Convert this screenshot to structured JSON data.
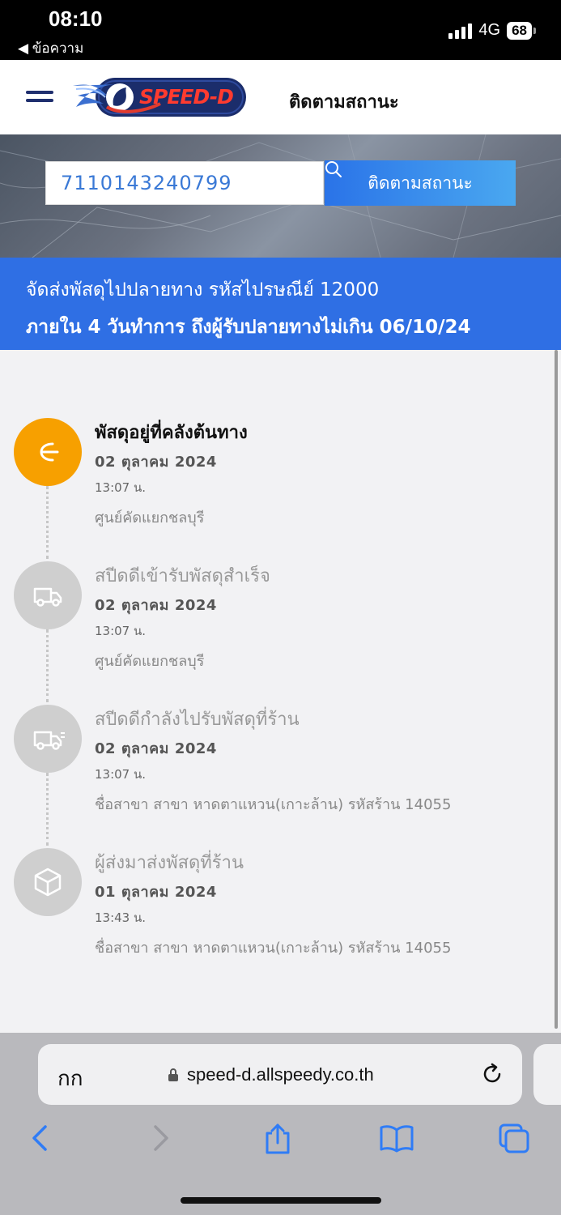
{
  "status_bar": {
    "time": "08:10",
    "back_label": "◀ ข้อความ",
    "network": "4G",
    "battery": "68"
  },
  "header": {
    "logo_text": "SPEED-D",
    "title": "ติดตามสถานะ"
  },
  "search": {
    "value": "7110143240799",
    "button_label": "ติดตามสถานะ"
  },
  "banner": {
    "line1": "จัดส่งพัสดุไปปลายทาง รหัสไปรษณีย์ 12000",
    "line2": "ภายใน 4 วันทำการ ถึงผู้รับปลายทางไม่เกิน 06/10/24"
  },
  "events": [
    {
      "title": "พัสดุอยู่ที่คลังต้นทาง",
      "date": "02 ตุลาคม 2024",
      "time": "13:07 น.",
      "location": "ศูนย์คัดแยกชลบุรี",
      "icon": "warehouse-arrow-icon",
      "active": true
    },
    {
      "title": "สปีดดีเข้ารับพัสดุสำเร็จ",
      "date": "02 ตุลาคม 2024",
      "time": "13:07 น.",
      "location": "ศูนย์คัดแยกชลบุรี",
      "icon": "truck-icon",
      "active": false
    },
    {
      "title": "สปีดดีกำลังไปรับพัสดุที่ร้าน",
      "date": "02 ตุลาคม 2024",
      "time": "13:07 น.",
      "location": "ชื่อสาขา สาขา หาดตาแหวน(เกาะล้าน) รหัสร้าน 14055",
      "icon": "fast-truck-icon",
      "active": false
    },
    {
      "title": "ผู้ส่งมาส่งพัสดุที่ร้าน",
      "date": "01 ตุลาคม 2024",
      "time": "13:43 น.",
      "location": "ชื่อสาขา สาขา หาดตาแหวน(เกาะล้าน) รหัสร้าน 14055",
      "icon": "package-box-icon",
      "active": false
    }
  ],
  "browser": {
    "aa_label": "กก",
    "url": "speed-d.allspeedy.co.th"
  },
  "colors": {
    "accent_blue": "#2f6fe4",
    "active_orange": "#f7a000",
    "inactive_gray": "#cfcfcf"
  }
}
